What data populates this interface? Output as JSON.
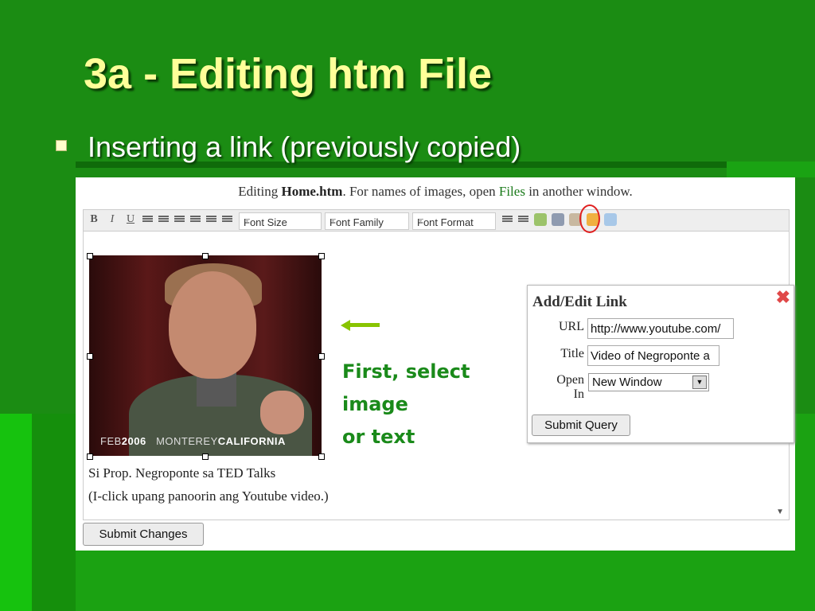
{
  "slide": {
    "title": "3a - Editing htm File",
    "bullet": "Inserting a link (previously copied)"
  },
  "editor": {
    "header": {
      "prefix": "Editing ",
      "filename": "Home.htm",
      "middle": ". For names of images, open ",
      "files_link": "Files",
      "suffix": " in another window."
    },
    "toolbar": {
      "bold": "B",
      "italic": "I",
      "underline": "U",
      "font_size": "Font Size",
      "font_family": "Font Family",
      "font_format": "Font Format"
    },
    "photo_caption_left": "FEB",
    "photo_caption_year": "2006",
    "photo_caption_place": "MONTEREY",
    "photo_caption_state": "CALIFORNIA",
    "content_line1": "Si Prop. Negroponte sa TED Talks",
    "content_line2": "(I-click upang panoorin ang Youtube video.)",
    "submit_changes": "Submit Changes"
  },
  "dialog": {
    "title": "Add/Edit Link",
    "close": "✖",
    "url_label": "URL",
    "url_value": "http://www.youtube.com/",
    "title_label": "Title",
    "title_value": "Video of Negroponte a",
    "open_label_1": "Open",
    "open_label_2": "In",
    "open_value": "New Window",
    "submit": "Submit Query"
  },
  "annotation": {
    "line1": "First, select",
    "line2": "image",
    "line3": "or text",
    "accent_color": "#1a8a1a",
    "arrow_color": "#88c400"
  }
}
